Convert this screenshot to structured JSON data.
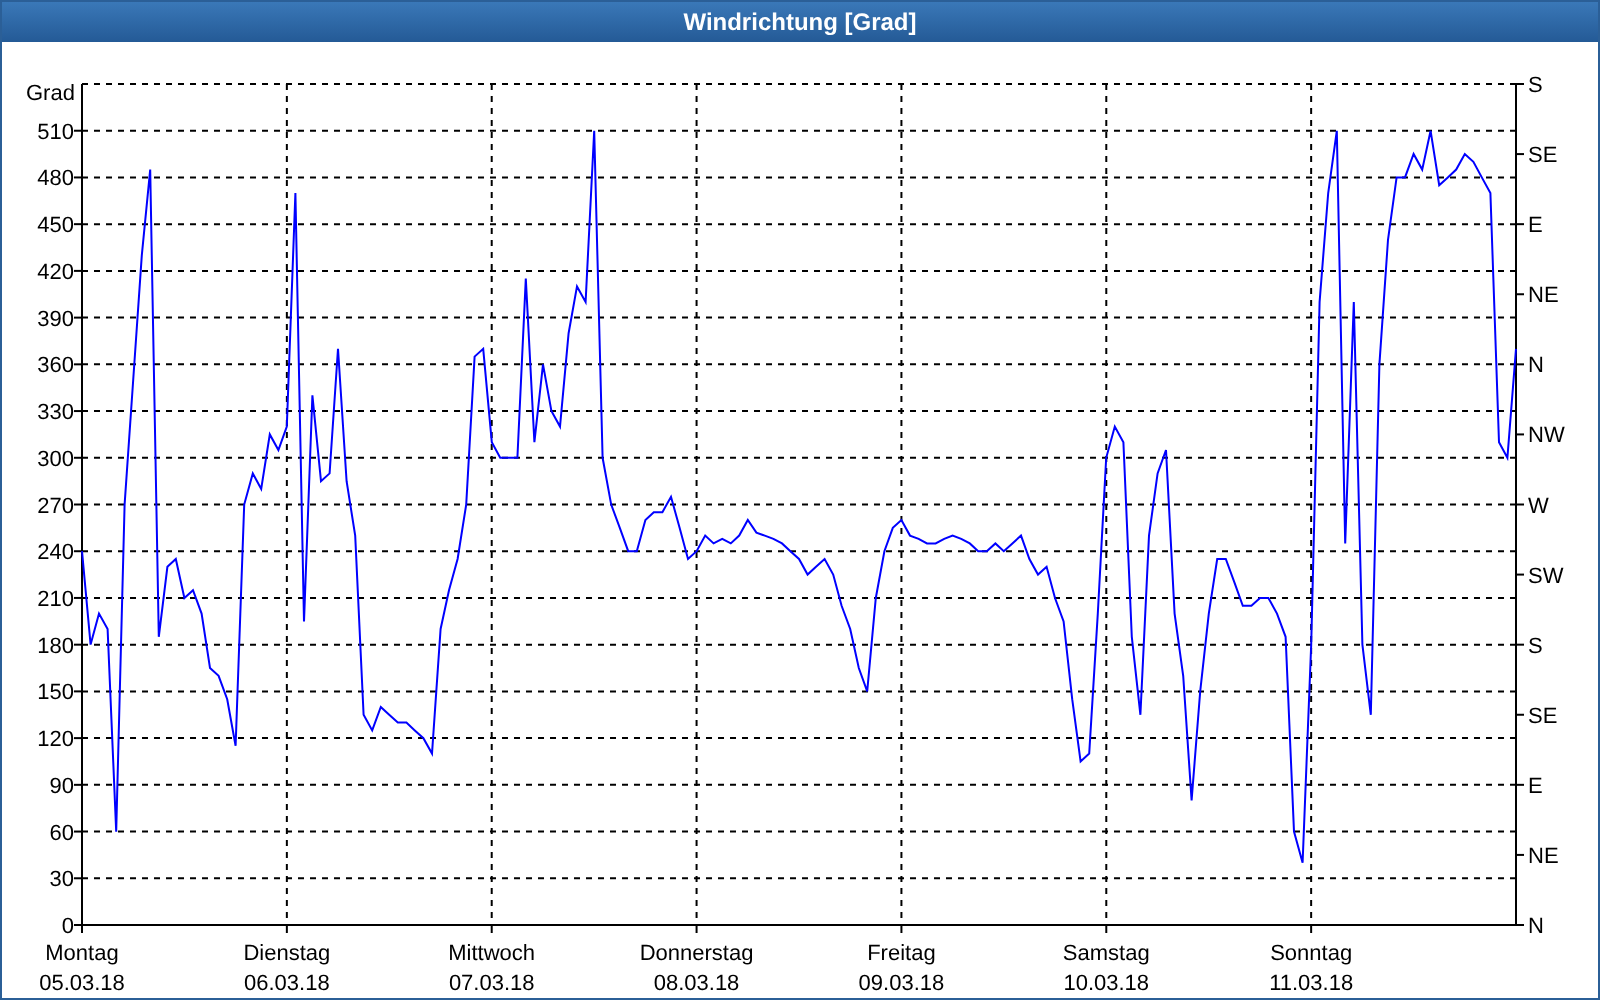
{
  "window": {
    "title": "Windrichtung [Grad]"
  },
  "chart_data": {
    "type": "line",
    "grid": true,
    "ylabel": "Grad",
    "ylim": [
      0,
      540
    ],
    "categories": [
      "Montag\n05.03.18",
      null,
      null,
      null,
      null,
      null,
      null,
      null,
      null,
      null,
      null,
      null,
      null,
      null,
      null,
      null,
      null,
      null,
      null,
      null,
      null,
      null,
      null,
      null,
      "Dienstag\n06.03.18",
      null,
      null,
      null,
      null,
      null,
      null,
      null,
      null,
      null,
      null,
      null,
      null,
      null,
      null,
      null,
      null,
      null,
      null,
      null,
      null,
      null,
      null,
      null,
      "Mittwoch\n07.03.18",
      null,
      null,
      null,
      null,
      null,
      null,
      null,
      null,
      null,
      null,
      null,
      null,
      null,
      null,
      null,
      null,
      null,
      null,
      null,
      null,
      null,
      null,
      null,
      "Donnerstag\n08.03.18",
      null,
      null,
      null,
      null,
      null,
      null,
      null,
      null,
      null,
      null,
      null,
      null,
      null,
      null,
      null,
      null,
      null,
      null,
      null,
      null,
      null,
      null,
      null,
      "Freitag\n09.03.18",
      null,
      null,
      null,
      null,
      null,
      null,
      null,
      null,
      null,
      null,
      null,
      null,
      null,
      null,
      null,
      null,
      null,
      null,
      null,
      null,
      null,
      null,
      null,
      "Samstag\n10.03.18",
      null,
      null,
      null,
      null,
      null,
      null,
      null,
      null,
      null,
      null,
      null,
      null,
      null,
      null,
      null,
      null,
      null,
      null,
      null,
      null,
      null,
      null,
      null,
      "Sonntag\n11.03.18",
      null,
      null,
      null,
      null,
      null,
      null,
      null,
      null,
      null,
      null,
      null,
      null,
      null,
      null,
      null,
      null,
      null,
      null,
      null,
      null,
      null,
      null,
      null,
      null
    ],
    "yticks": [
      0,
      30,
      60,
      90,
      120,
      150,
      180,
      210,
      240,
      270,
      300,
      330,
      360,
      390,
      420,
      450,
      480,
      510
    ],
    "series": [
      {
        "color": "#0000ff",
        "values": [
          240,
          180,
          200,
          190,
          60,
          270,
          350,
          430,
          485,
          185,
          230,
          235,
          210,
          215,
          200,
          165,
          160,
          145,
          115,
          270,
          290,
          280,
          315,
          305,
          320,
          470,
          195,
          340,
          285,
          290,
          370,
          285,
          250,
          135,
          125,
          140,
          135,
          130,
          130,
          125,
          120,
          110,
          190,
          215,
          235,
          270,
          365,
          370,
          310,
          300,
          300,
          300,
          415,
          310,
          360,
          330,
          320,
          380,
          410,
          400,
          510,
          300,
          270,
          255,
          240,
          240,
          260,
          265,
          265,
          275,
          255,
          235,
          240,
          250,
          245,
          248,
          245,
          250,
          260,
          252,
          250,
          248,
          245,
          240,
          235,
          225,
          230,
          235,
          225,
          205,
          190,
          165,
          150,
          210,
          240,
          255,
          260,
          250,
          248,
          245,
          245,
          248,
          250,
          248,
          245,
          240,
          240,
          245,
          240,
          245,
          250,
          235,
          225,
          230,
          210,
          195,
          145,
          105,
          110,
          200,
          300,
          320,
          310,
          185,
          135,
          250,
          290,
          305,
          200,
          160,
          80,
          150,
          200,
          235,
          235,
          220,
          205,
          205,
          210,
          210,
          200,
          185,
          60,
          40,
          180,
          400,
          470,
          510,
          245,
          400,
          180,
          135,
          360,
          440,
          480,
          480,
          495,
          485,
          510,
          475,
          480,
          485,
          495,
          490,
          480,
          470,
          310,
          300,
          370
        ]
      }
    ]
  },
  "compass_axis": {
    "labels": [
      "S",
      "SE",
      "E",
      "NE",
      "N",
      "NW",
      "W",
      "SW",
      "S",
      "SE",
      "E",
      "NE",
      "N"
    ]
  }
}
